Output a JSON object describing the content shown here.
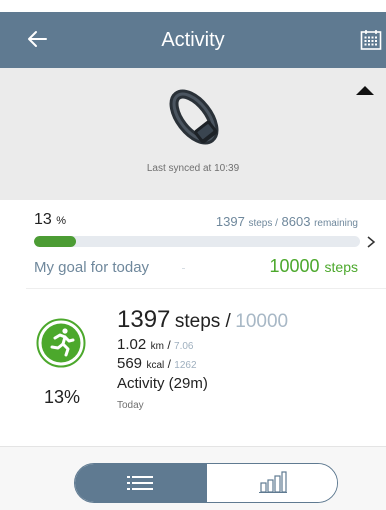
{
  "header": {
    "title": "Activity",
    "back_icon": "back-arrow-icon",
    "calendar_icon": "calendar-icon",
    "background": "#5f7a91"
  },
  "device": {
    "icon": "fitness-band-icon",
    "sync_text": "Last synced at 10:39",
    "collapse_icon": "collapse-triangle-icon"
  },
  "progress": {
    "percent": "13",
    "percent_unit": "%",
    "steps": "1397",
    "steps_label": "steps /",
    "remaining": "8603",
    "remaining_label": "remaining",
    "fill_fraction": 0.13,
    "fill_color": "#4c9c34"
  },
  "goal": {
    "label": "My goal for today",
    "value": "10000",
    "unit": "steps",
    "color": "#4ca82c"
  },
  "summary": {
    "icon": "running-person-icon",
    "percent": "13%",
    "steps": "1397",
    "steps_unit": "steps /",
    "steps_goal": "10000",
    "distance": "1.02",
    "distance_unit": "km",
    "distance_target": "7.06",
    "calories": "569",
    "calories_unit": "kcal",
    "calories_target": "1262",
    "activity": "Activity (29m)",
    "day": "Today"
  },
  "view_toggle": {
    "selected": "list",
    "list_icon": "list-icon",
    "chart_icon": "bar-chart-icon"
  }
}
